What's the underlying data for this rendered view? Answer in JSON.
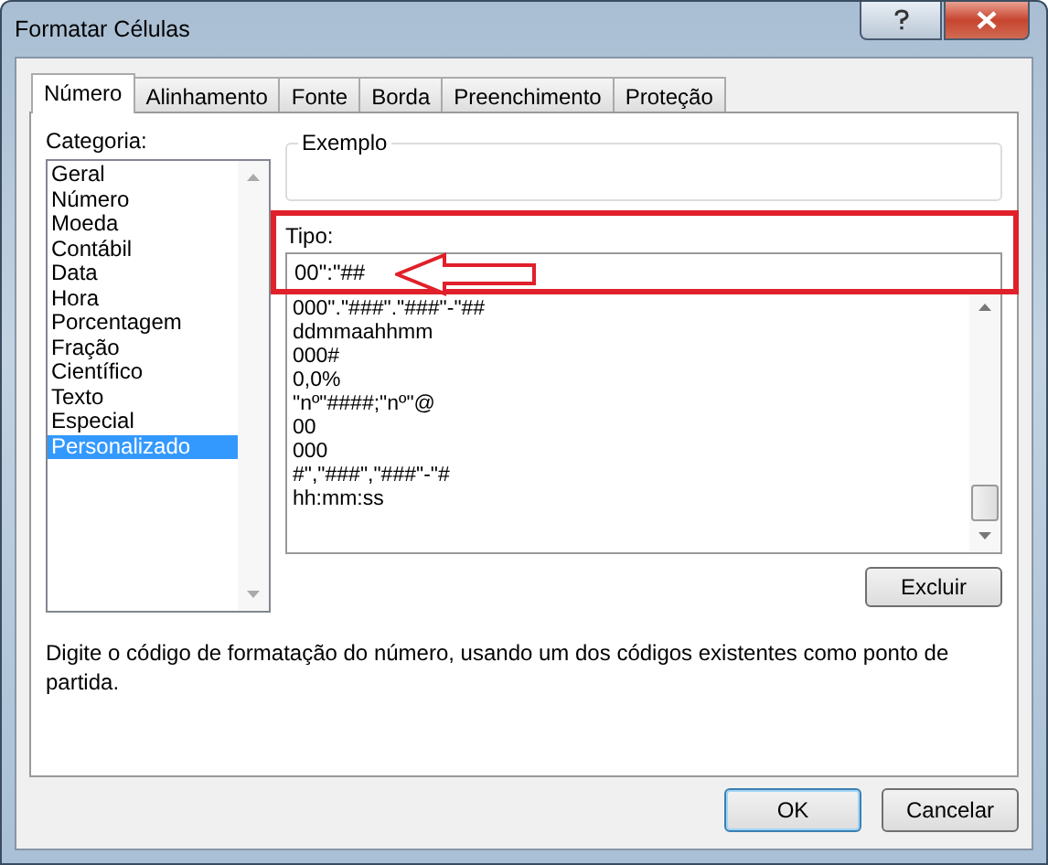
{
  "window": {
    "title": "Formatar Células"
  },
  "tabs": [
    {
      "label": "Número",
      "selected": true
    },
    {
      "label": "Alinhamento",
      "selected": false
    },
    {
      "label": "Fonte",
      "selected": false
    },
    {
      "label": "Borda",
      "selected": false
    },
    {
      "label": "Preenchimento",
      "selected": false
    },
    {
      "label": "Proteção",
      "selected": false
    }
  ],
  "categories": {
    "label": "Categoria:",
    "items": [
      {
        "label": "Geral",
        "selected": false
      },
      {
        "label": "Número",
        "selected": false
      },
      {
        "label": "Moeda",
        "selected": false
      },
      {
        "label": "Contábil",
        "selected": false
      },
      {
        "label": "Data",
        "selected": false
      },
      {
        "label": "Hora",
        "selected": false
      },
      {
        "label": "Porcentagem",
        "selected": false
      },
      {
        "label": "Fração",
        "selected": false
      },
      {
        "label": "Científico",
        "selected": false
      },
      {
        "label": "Texto",
        "selected": false
      },
      {
        "label": "Especial",
        "selected": false
      },
      {
        "label": "Personalizado",
        "selected": true
      }
    ]
  },
  "sample": {
    "label": "Exemplo"
  },
  "type": {
    "label": "Tipo:",
    "value": "00\":\"##",
    "formats": [
      "000\".\"###\".\"###\"-\"##",
      "ddmmaahhmm",
      "000#",
      "0,0%",
      "\"nº\"####;\"nº\"@",
      "00",
      "000",
      "#\",\"###\",\"###\"-\"#",
      "hh:mm:ss"
    ]
  },
  "delete_button": "Excluir",
  "description": "Digite o código de formatação do número, usando um dos códigos existentes como ponto de partida.",
  "buttons": [
    {
      "label": "OK",
      "kind": "default"
    },
    {
      "label": "Cancelar",
      "kind": "normal"
    }
  ]
}
